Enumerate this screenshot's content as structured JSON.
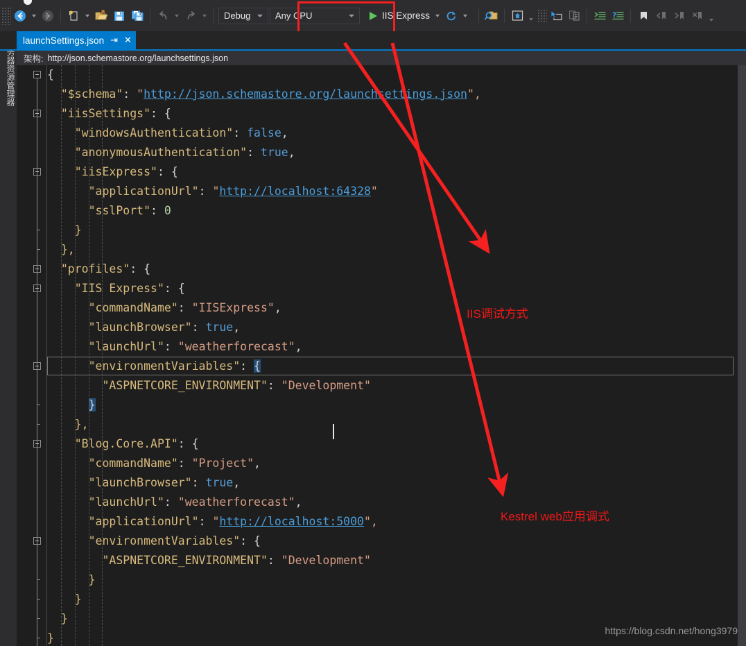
{
  "toolbar": {
    "nav_back_icon": "navigate-back-icon",
    "nav_forward_icon": "navigate-forward-icon",
    "new_item_icon": "new-item-icon",
    "open_folder_icon": "open-folder-icon",
    "save_icon": "save-icon",
    "save_all_icon": "save-all-icon",
    "undo_icon": "undo-icon",
    "redo_icon": "redo-icon",
    "config_value": "Debug",
    "platform_value": "Any CPU",
    "run_label": "IIS Express",
    "play_icon": "play-triangle-icon",
    "refresh_icon": "refresh-icon",
    "find_icon": "find-in-files-icon",
    "home_icon": "home-icon",
    "pointer_icon": "pointer-select-icon",
    "compare_icon": "compare-files-icon",
    "indent_icon": "format-document-icon",
    "comment_icon": "comment-selection-icon",
    "bookmark_icon": "bookmark-icon",
    "bookmark_prev_icon": "previous-bookmark-icon",
    "bookmark_next_icon": "next-bookmark-icon",
    "bookmark_clear_icon": "clear-bookmarks-icon",
    "overflow_icon": "toolbar-overflow-icon"
  },
  "left_dock": {
    "server_explorer_label": "服务器资源管理器"
  },
  "tab": {
    "title": "launchSettings.json",
    "pin_icon": "pin-icon",
    "close_icon": "close-icon"
  },
  "schema_bar": {
    "label": "架构:",
    "url": "http://json.schemastore.org/launchsettings.json"
  },
  "annotations": {
    "iis": "IIS调试方式",
    "kestrel": "Kestrel web应用调式",
    "accent_color": "#f01818"
  },
  "watermark": "https://blog.csdn.net/hong3979",
  "editor": {
    "lines": [
      {
        "indent": 0,
        "tokens": [
          {
            "t": "{",
            "c": "p"
          }
        ]
      },
      {
        "indent": 1,
        "tokens": [
          {
            "t": "\"$schema\"",
            "c": "k"
          },
          {
            "t": ": ",
            "c": "p"
          },
          {
            "t": "\"",
            "c": "s"
          },
          {
            "t": "http://json.schemastore.org/launchsettings.json",
            "c": "u"
          },
          {
            "t": "\",",
            "c": "s"
          }
        ]
      },
      {
        "indent": 1,
        "tokens": [
          {
            "t": "\"iisSettings\"",
            "c": "k"
          },
          {
            "t": ": {",
            "c": "p"
          }
        ]
      },
      {
        "indent": 2,
        "tokens": [
          {
            "t": "\"windowsAuthentication\"",
            "c": "k"
          },
          {
            "t": ": ",
            "c": "p"
          },
          {
            "t": "false",
            "c": "b"
          },
          {
            "t": ",",
            "c": "p"
          }
        ]
      },
      {
        "indent": 2,
        "tokens": [
          {
            "t": "\"anonymousAuthentication\"",
            "c": "k"
          },
          {
            "t": ": ",
            "c": "p"
          },
          {
            "t": "true",
            "c": "b"
          },
          {
            "t": ",",
            "c": "p"
          }
        ]
      },
      {
        "indent": 2,
        "tokens": [
          {
            "t": "\"iisExpress\"",
            "c": "k"
          },
          {
            "t": ": {",
            "c": "p"
          }
        ]
      },
      {
        "indent": 3,
        "tokens": [
          {
            "t": "\"applicationUrl\"",
            "c": "k"
          },
          {
            "t": ": ",
            "c": "p"
          },
          {
            "t": "\"",
            "c": "s"
          },
          {
            "t": "http://localhost:64328",
            "c": "u"
          },
          {
            "t": "\"",
            "c": "s"
          }
        ]
      },
      {
        "indent": 3,
        "tokens": [
          {
            "t": "\"sslPort\"",
            "c": "k"
          },
          {
            "t": ": ",
            "c": "p"
          },
          {
            "t": "0",
            "c": "n"
          }
        ]
      },
      {
        "indent": 2,
        "tokens": [
          {
            "t": "}",
            "c": "k"
          }
        ]
      },
      {
        "indent": 1,
        "tokens": [
          {
            "t": "},",
            "c": "k"
          }
        ]
      },
      {
        "indent": 1,
        "tokens": [
          {
            "t": "\"profiles\"",
            "c": "k"
          },
          {
            "t": ": {",
            "c": "p"
          }
        ]
      },
      {
        "indent": 2,
        "tokens": [
          {
            "t": "\"IIS Express\"",
            "c": "k"
          },
          {
            "t": ": {",
            "c": "p"
          }
        ]
      },
      {
        "indent": 3,
        "tokens": [
          {
            "t": "\"commandName\"",
            "c": "k"
          },
          {
            "t": ": ",
            "c": "p"
          },
          {
            "t": "\"IISExpress\"",
            "c": "s"
          },
          {
            "t": ",",
            "c": "p"
          }
        ]
      },
      {
        "indent": 3,
        "tokens": [
          {
            "t": "\"launchBrowser\"",
            "c": "k"
          },
          {
            "t": ": ",
            "c": "p"
          },
          {
            "t": "true",
            "c": "b"
          },
          {
            "t": ",",
            "c": "p"
          }
        ]
      },
      {
        "indent": 3,
        "tokens": [
          {
            "t": "\"launchUrl\"",
            "c": "k"
          },
          {
            "t": ": ",
            "c": "p"
          },
          {
            "t": "\"weatherforecast\"",
            "c": "s"
          },
          {
            "t": ",",
            "c": "p"
          }
        ]
      },
      {
        "indent": 3,
        "tokens": [
          {
            "t": "\"environmentVariables\"",
            "c": "k"
          },
          {
            "t": ": ",
            "c": "p"
          },
          {
            "t": "{",
            "c": "br-hl"
          }
        ]
      },
      {
        "indent": 4,
        "tokens": [
          {
            "t": "\"ASPNETCORE_ENVIRONMENT\"",
            "c": "k"
          },
          {
            "t": ": ",
            "c": "p"
          },
          {
            "t": "\"Development\"",
            "c": "s"
          }
        ]
      },
      {
        "indent": 3,
        "tokens": [
          {
            "t": "}",
            "c": "br-hl"
          }
        ]
      },
      {
        "indent": 2,
        "tokens": [
          {
            "t": "},",
            "c": "k"
          }
        ]
      },
      {
        "indent": 2,
        "tokens": [
          {
            "t": "\"Blog.Core.API\"",
            "c": "k"
          },
          {
            "t": ": {",
            "c": "p"
          }
        ]
      },
      {
        "indent": 3,
        "tokens": [
          {
            "t": "\"commandName\"",
            "c": "k"
          },
          {
            "t": ": ",
            "c": "p"
          },
          {
            "t": "\"Project\"",
            "c": "s"
          },
          {
            "t": ",",
            "c": "p"
          }
        ]
      },
      {
        "indent": 3,
        "tokens": [
          {
            "t": "\"launchBrowser\"",
            "c": "k"
          },
          {
            "t": ": ",
            "c": "p"
          },
          {
            "t": "true",
            "c": "b"
          },
          {
            "t": ",",
            "c": "p"
          }
        ]
      },
      {
        "indent": 3,
        "tokens": [
          {
            "t": "\"launchUrl\"",
            "c": "k"
          },
          {
            "t": ": ",
            "c": "p"
          },
          {
            "t": "\"weatherforecast\"",
            "c": "s"
          },
          {
            "t": ",",
            "c": "p"
          }
        ]
      },
      {
        "indent": 3,
        "tokens": [
          {
            "t": "\"applicationUrl\"",
            "c": "k"
          },
          {
            "t": ": ",
            "c": "p"
          },
          {
            "t": "\"",
            "c": "s"
          },
          {
            "t": "http://localhost:5000",
            "c": "u"
          },
          {
            "t": "\",",
            "c": "s"
          }
        ]
      },
      {
        "indent": 3,
        "tokens": [
          {
            "t": "\"environmentVariables\"",
            "c": "k"
          },
          {
            "t": ": {",
            "c": "p"
          }
        ]
      },
      {
        "indent": 4,
        "tokens": [
          {
            "t": "\"ASPNETCORE_ENVIRONMENT\"",
            "c": "k"
          },
          {
            "t": ": ",
            "c": "p"
          },
          {
            "t": "\"Development\"",
            "c": "s"
          }
        ]
      },
      {
        "indent": 3,
        "tokens": [
          {
            "t": "}",
            "c": "k"
          }
        ]
      },
      {
        "indent": 2,
        "tokens": [
          {
            "t": "}",
            "c": "k"
          }
        ]
      },
      {
        "indent": 1,
        "tokens": [
          {
            "t": "}",
            "c": "k"
          }
        ]
      },
      {
        "indent": 0,
        "tokens": [
          {
            "t": "}",
            "c": "k"
          }
        ]
      }
    ],
    "fold_line_indexes": [
      0,
      2,
      5,
      10,
      11,
      15,
      19,
      24
    ],
    "tick_line_indexes": [
      8,
      9,
      17,
      18,
      26,
      27,
      28,
      29
    ]
  }
}
